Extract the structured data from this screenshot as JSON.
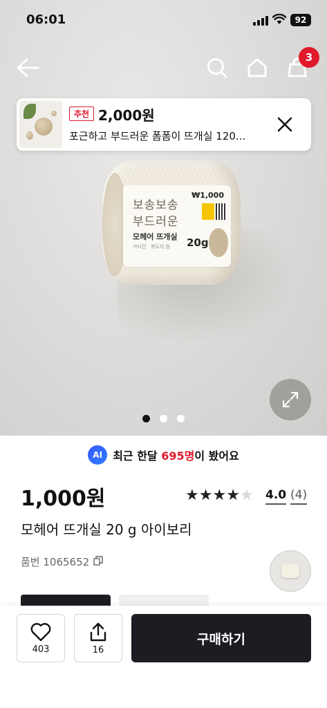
{
  "status_bar": {
    "time": "06:01",
    "battery": "92",
    "icons": [
      "signal-icon",
      "wifi-icon",
      "battery-icon"
    ]
  },
  "nav": {
    "icons": [
      "back-arrow-icon",
      "search-icon",
      "home-icon",
      "shopping-bag-icon"
    ],
    "cart_count": "3"
  },
  "recommendation": {
    "tag": "추천",
    "price": "2,000원",
    "title": "포근하고 부드러운 폼폼이 뜨개실 120..."
  },
  "product_image": {
    "label_line1": "보송보송",
    "label_line2": "부드러운",
    "label_line3": "모헤어 뜨개실",
    "label_line4": "가디건 · 목도리 등",
    "label_price": "₩1,000",
    "label_weight": "20g"
  },
  "carousel": {
    "total": 3,
    "active_index": 0
  },
  "viewers": {
    "badge": "AI",
    "prefix": "최근 한달 ",
    "count": "695명",
    "suffix": "이 봤어요"
  },
  "product": {
    "price": "1,000원",
    "rating": "4.0",
    "review_count": "(4)",
    "stars": 4,
    "max_stars": 5,
    "name": "모헤어 뜨개실 20 g 아이보리",
    "sku": "품번 1065652"
  },
  "actions": {
    "likes": "403",
    "shares": "16",
    "buy_label": "구매하기"
  },
  "colors": {
    "accent_red": "#e0192b",
    "dark": "#1b1d22",
    "ai_blue": "#2a6bff"
  }
}
